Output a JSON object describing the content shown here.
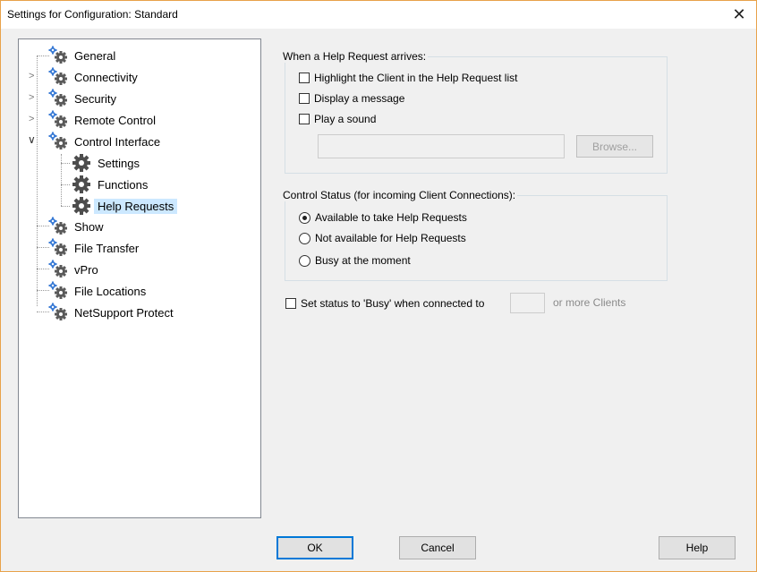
{
  "window": {
    "title": "Settings for Configuration: Standard",
    "close_glyph": "✕"
  },
  "tree": {
    "items": [
      {
        "label": "General",
        "icon": "gear-icon"
      },
      {
        "label": "Connectivity",
        "icon": "gear-icon",
        "expandable": true
      },
      {
        "label": "Security",
        "icon": "gear-icon",
        "expandable": true
      },
      {
        "label": "Remote Control",
        "icon": "gear-icon",
        "expandable": true
      },
      {
        "label": "Control Interface",
        "icon": "gear-icon",
        "expanded": true,
        "children": [
          {
            "label": "Settings",
            "icon": "large-gear-icon"
          },
          {
            "label": "Functions",
            "icon": "large-gear-icon"
          },
          {
            "label": "Help Requests",
            "icon": "large-gear-icon",
            "selected": true
          }
        ]
      },
      {
        "label": "Show",
        "icon": "gear-icon"
      },
      {
        "label": "File Transfer",
        "icon": "gear-icon"
      },
      {
        "label": "vPro",
        "icon": "gear-icon"
      },
      {
        "label": "File Locations",
        "icon": "gear-icon"
      },
      {
        "label": "NetSupport Protect",
        "icon": "gear-icon"
      }
    ]
  },
  "help_request_group": {
    "label": "When a Help Request arrives:",
    "highlight_label": "Highlight the Client in the Help Request list",
    "message_label": "Display a message",
    "sound_label": "Play a sound",
    "sound_path": "",
    "browse_label": "Browse..."
  },
  "status_group": {
    "label": "Control Status (for incoming Client Connections):",
    "options": [
      {
        "label": "Available to take Help Requests",
        "selected": true
      },
      {
        "label": "Not available for Help Requests",
        "selected": false
      },
      {
        "label": "Busy at the moment",
        "selected": false
      }
    ]
  },
  "busy_option": {
    "prefix": "Set status to 'Busy' when connected to",
    "value": "",
    "suffix": "or more Clients"
  },
  "buttons": {
    "ok": "OK",
    "cancel": "Cancel",
    "help": "Help"
  },
  "colors": {
    "selection": "#cce8ff",
    "default_button_border": "#0078d7",
    "window_border": "#e8a24a"
  }
}
